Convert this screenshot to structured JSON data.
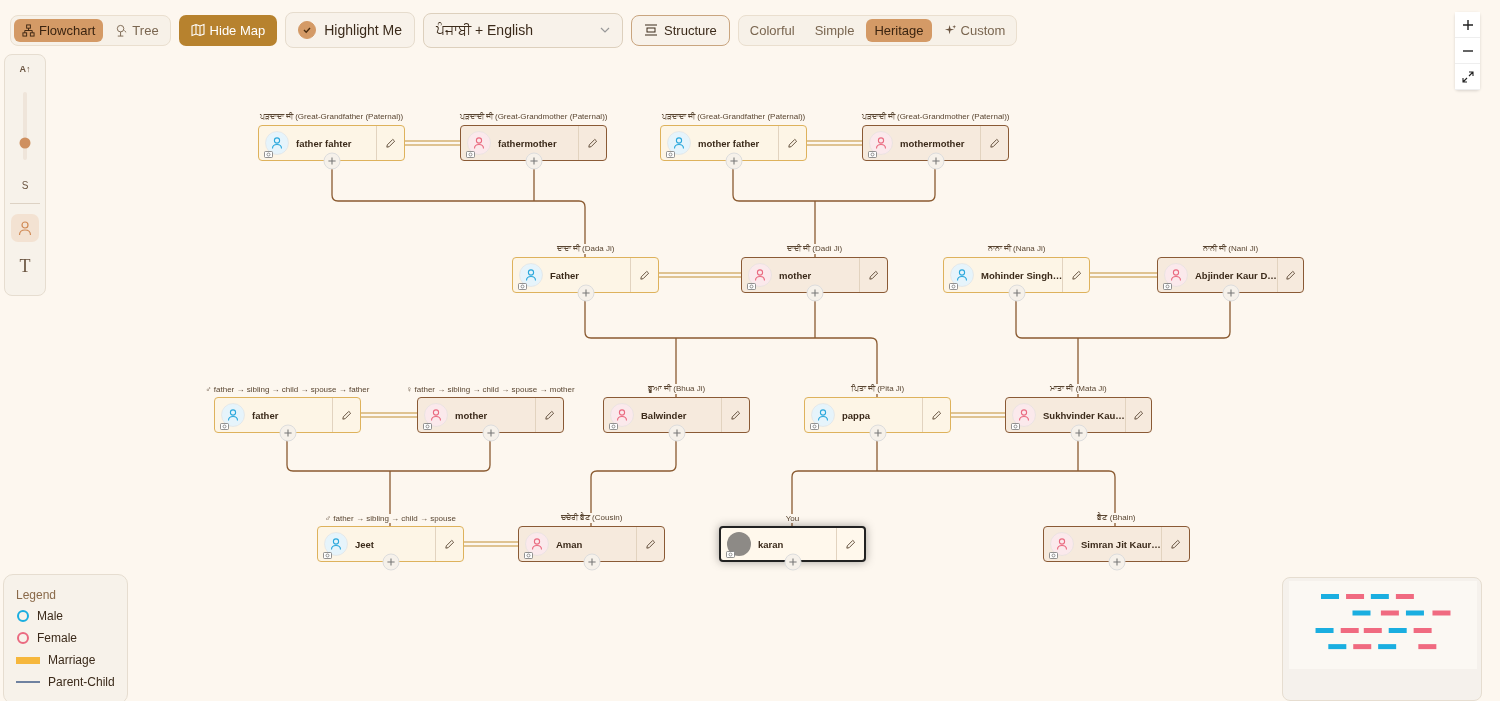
{
  "view_toggle": [
    {
      "label": "Flowchart",
      "kind": "flowchart",
      "selected": true
    },
    {
      "label": "Tree",
      "kind": "tree",
      "selected": false
    }
  ],
  "map_button": {
    "label": "Hide Map"
  },
  "highlight": {
    "label": "Highlight Me",
    "checked": true
  },
  "language": {
    "value": "ਪੰਜਾਬੀ + English"
  },
  "structure_button": {
    "label": "Structure"
  },
  "themes": [
    {
      "label": "Colorful",
      "selected": false
    },
    {
      "label": "Simple",
      "selected": false
    },
    {
      "label": "Heritage",
      "selected": true
    },
    {
      "label": "Custom",
      "selected": false,
      "icon": true
    }
  ],
  "side_panel": {
    "size_label": "A↑",
    "level": 0.25,
    "reading": "S",
    "tools": [
      {
        "kind": "person",
        "selected": true
      },
      {
        "kind": "text",
        "label": "T",
        "selected": false
      }
    ]
  },
  "generations": [
    {
      "members": [
        {
          "relation": "ਪੜਦਾਦਾ ਜੀ (Great-Grandfather (Paternal))",
          "name": "father fahter",
          "kind": "male",
          "highlighted": false,
          "photo": false
        },
        {
          "relation": "ਪੜਦਾਦੀ ਜੀ (Great-Grandmother (Paternal))",
          "name": "fathermother",
          "kind": "female",
          "highlighted": false,
          "photo": false
        },
        {
          "relation": "ਪੜਦਾਦਾ ਜੀ (Great-Grandfather (Paternal))",
          "name": "mother father",
          "kind": "male",
          "highlighted": false,
          "photo": false
        },
        {
          "relation": "ਪੜਦਾਦੀ ਜੀ (Great-Grandmother (Paternal))",
          "name": "mothermother",
          "kind": "female",
          "highlighted": false,
          "photo": false
        }
      ]
    },
    {
      "members": [
        {
          "relation": "ਦਾਦਾ ਜੀ (Dada Ji)",
          "name": "Father",
          "kind": "male",
          "highlighted": false,
          "photo": false
        },
        {
          "relation": "ਦਾਦੀ ਜੀ (Dadi Ji)",
          "name": "mother",
          "kind": "female",
          "highlighted": false,
          "photo": false
        },
        {
          "relation": "ਨਾਨਾ ਜੀ (Nana Ji)",
          "name": "Mohinder Singh…",
          "kind": "male",
          "highlighted": false,
          "photo": false
        },
        {
          "relation": "ਨਾਨੀ ਜੀ (Nani Ji)",
          "name": "Abjinder Kaur D…",
          "kind": "female",
          "highlighted": false,
          "photo": false
        }
      ]
    },
    {
      "members": [
        {
          "relation": "♂ father → sibling → child → spouse → father",
          "name": "father",
          "kind": "male",
          "highlighted": false,
          "photo": false
        },
        {
          "relation": "♀ father → sibling → child → spouse → mother",
          "name": "mother",
          "kind": "female",
          "highlighted": false,
          "photo": false
        },
        {
          "relation": "ਭੂਆ ਜੀ (Bhua Ji)",
          "name": "Balwinder",
          "kind": "female",
          "highlighted": false,
          "photo": false
        },
        {
          "relation": "ਪਿਤਾ ਜੀ (Pita Ji)",
          "name": "pappa",
          "kind": "male",
          "highlighted": false,
          "photo": false
        },
        {
          "relation": "ਮਾਤਾ ਜੀ (Mata Ji)",
          "name": "Sukhvinder Kau…",
          "kind": "female",
          "highlighted": false,
          "photo": false
        }
      ]
    },
    {
      "members": [
        {
          "relation": "♂ father → sibling → child → spouse",
          "name": "Jeet",
          "kind": "male",
          "highlighted": false,
          "photo": false
        },
        {
          "relation": "ਚਚੇਰੀ ਭੈਣ (Cousin)",
          "name": "Aman",
          "kind": "female",
          "highlighted": false,
          "photo": false
        },
        {
          "relation": "You",
          "name": "karan",
          "kind": "male",
          "highlighted": true,
          "photo": true
        },
        {
          "relation": "ਭੈਣ (Bhain)",
          "name": "Simran Jit Kaur…",
          "kind": "female",
          "highlighted": false,
          "photo": false
        }
      ]
    }
  ],
  "legend": {
    "title": "Legend",
    "items": [
      {
        "label": "Male",
        "kind": "ring",
        "color": "#1aaee0"
      },
      {
        "label": "Female",
        "kind": "ring",
        "color": "#ea6a80"
      },
      {
        "label": "Marriage",
        "kind": "bar",
        "color": "#f6b73c"
      },
      {
        "label": "Parent-Child",
        "kind": "line",
        "color": "#6f82a0"
      }
    ]
  }
}
